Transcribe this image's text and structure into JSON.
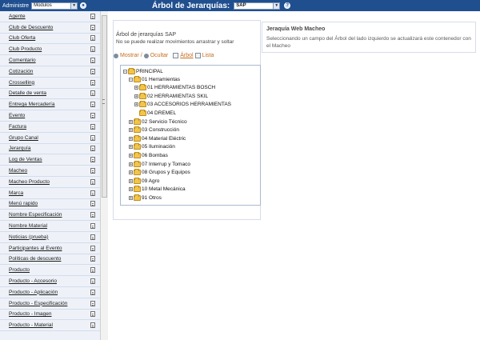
{
  "header": {
    "admin_label": "Administre",
    "module_select_value": "Modulos",
    "title": "Árbol de Jerarquías:",
    "sap_select_value": "SAP"
  },
  "sidebar": {
    "items": [
      {
        "label": "Agente"
      },
      {
        "label": "Club de Descuento"
      },
      {
        "label": "Club Oferta"
      },
      {
        "label": "Club Producto"
      },
      {
        "label": "Comentario"
      },
      {
        "label": "Cotización"
      },
      {
        "label": "Crosselling"
      },
      {
        "label": "Detalle de venta"
      },
      {
        "label": "Entrega Mercadería"
      },
      {
        "label": "Evento"
      },
      {
        "label": "Factura"
      },
      {
        "label": "Grupo Canal"
      },
      {
        "label": "Jerarquía"
      },
      {
        "label": "Log de Ventas"
      },
      {
        "label": "Macheo"
      },
      {
        "label": "Macheo Producto"
      },
      {
        "label": "Marca"
      },
      {
        "label": "Menú rapido"
      },
      {
        "label": "Nombre Especificación"
      },
      {
        "label": "Nombre Material"
      },
      {
        "label": "Noticias (prueba)"
      },
      {
        "label": "Participantes al Evento"
      },
      {
        "label": "Políticas de descuento"
      },
      {
        "label": "Producto"
      },
      {
        "label": "Producto - Accesorio"
      },
      {
        "label": "Producto - Aplicación"
      },
      {
        "label": "Producto - Especificación"
      },
      {
        "label": "Producto - Imagen"
      },
      {
        "label": "Producto - Material"
      }
    ]
  },
  "tree_panel": {
    "title": "Árbol de jerarquías SAP",
    "note": "No se puede realizar movimientos arrastrar y soltar",
    "toolbar": {
      "show": "Mostrar",
      "sep": "/",
      "hide": "Ocultar",
      "tree": "Árbol",
      "list": "Lista"
    },
    "nodes": {
      "principal": "PRINCIPAL",
      "herramientas": "01 Herramientas",
      "bosch": "01 HERRAMIENTAS BOSCH",
      "skil": "02 HERRAMIENTAS SKIL",
      "accesorios": "03 ACCESORIOS HERRAMIENTAS",
      "dremel": "04 DREMEL",
      "servicio": "02 Servicio Técnico",
      "construccion": "03 Construcción",
      "material_electric": "04 Material Eléctric",
      "iluminacion": "05 Iluminación",
      "bombas": "06 Bombas",
      "interrup": "07 Interrup y Tomaco",
      "grupos": "08 Grupos y Equipos",
      "agro": "09 Agro",
      "metal": "10 Metal Mecánica",
      "otros": "91 Otros"
    }
  },
  "info_panel": {
    "title": "Jeraquía Web Macheo",
    "text": "Seleccionando un campo del Árbol del lado izquierdo se actualizará este contenedor con el Macheo"
  }
}
